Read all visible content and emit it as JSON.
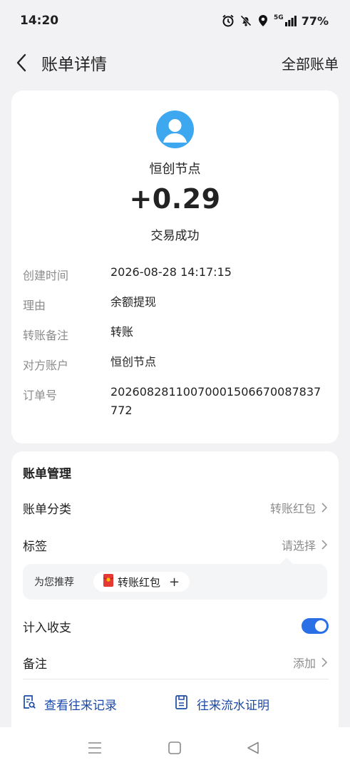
{
  "status_bar": {
    "time": "14:20",
    "network": "5G",
    "battery": "77%"
  },
  "header": {
    "title": "账单详情",
    "right_link": "全部账单"
  },
  "transaction": {
    "payee": "恒创节点",
    "amount": "+0.29",
    "status": "交易成功",
    "details": [
      {
        "label": "创建时间",
        "value": "2026-08-28 14:17:15"
      },
      {
        "label": "理由",
        "value": "余额提现"
      },
      {
        "label": "转账备注",
        "value": "转账"
      },
      {
        "label": "对方账户",
        "value": "恒创节点"
      },
      {
        "label": "订单号",
        "value": "20260828110070001506670087837772"
      }
    ]
  },
  "management": {
    "title": "账单管理",
    "category": {
      "label": "账单分类",
      "value": "转账红包"
    },
    "tag": {
      "label": "标签",
      "value": "请选择"
    },
    "recommend": {
      "label": "为您推荐",
      "chip": "转账红包",
      "add": "+"
    },
    "include": {
      "label": "计入收支",
      "enabled": true
    },
    "note": {
      "label": "备注",
      "value": "添加"
    },
    "links": {
      "history": "查看往来记录",
      "certificate": "往来流水证明"
    }
  },
  "colors": {
    "accent": "#2a6fe6",
    "link": "#1d4aa8",
    "avatar": "#3da7f0",
    "muted": "#8c8c8c",
    "background": "#f2f2f4"
  },
  "icons": [
    "alarm-icon",
    "bell-off-icon",
    "location-icon",
    "signal-icon",
    "back-icon",
    "avatar-icon",
    "chevron-right-icon",
    "red-packet-icon",
    "record-search-icon",
    "document-icon",
    "menu-icon",
    "home-square-icon",
    "back-triangle-icon"
  ]
}
